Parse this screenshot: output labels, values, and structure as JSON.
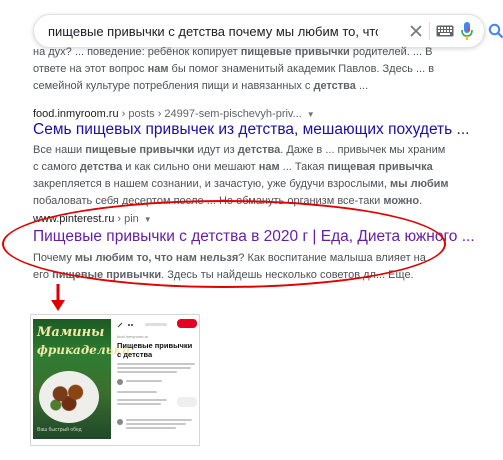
{
  "search": {
    "query": "пищевые привычки с детства почему мы любим то, что нам нельзя"
  },
  "icons": {
    "clear": "close-icon",
    "keyboard": "keyboard-icon",
    "voice": "microphone-icon",
    "search": "search-icon"
  },
  "colors": {
    "link": "#1a0dab",
    "visited": "#681da8",
    "highlight": "#e10000"
  },
  "result0": {
    "snippet_html": "на дух? ... поведение: ребёнок копирует <b>пищевые привычки</b> родителей. ... В ответе на этот вопрос <b>нам</b> бы помог знаменитый академик Павлов. Здесь ... в семейной культуре потребления пищи и навязанных с <b>детства</b> ..."
  },
  "result1": {
    "site": "food.inmyroom.ru",
    "path": " › posts › 24997-sem-pischevyh-priv...",
    "title": "Семь пищевых привычек из детства, мешающих похудеть ...",
    "snippet_html": "Все наши <b>пищевые привычки</b> идут из <b>детства</b>. Даже в ... привычек мы храним с самого <b>детства</b> и как сильно они мешают <b>нам</b> ... Такая <b>пищевая привычка</b> закрепляется в нашем сознании, и зачастую, уже будучи взрослыми, <b>мы любим</b> побаловать себя десертом после ... Но обмануть организм все-таки <b>можно</b>."
  },
  "result2": {
    "site": "www.pinterest.ru",
    "path": " › pin",
    "title": "Пищевые привычки с детства в 2020 г | Еда, Диета южного ...",
    "snippet_html": "Почему <b>мы любим то, что нам нельзя</b>? Как воспитание малыша влияет на его <b>пищевые привычки</b>. Здесь ты найдешь несколько советов дл... Еще."
  },
  "thumbnail": {
    "book_title_1": "Мамины",
    "book_title_2": "фрикадельки",
    "book_footer": "Ваш быстрый обед",
    "pin_title": "Пищевые привычки с детства"
  }
}
